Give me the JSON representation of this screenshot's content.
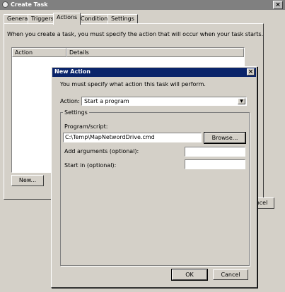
{
  "window": {
    "title": "Create Task",
    "tabs": [
      "General",
      "Triggers",
      "Actions",
      "Conditions",
      "Settings"
    ],
    "active_tab": "Actions",
    "instruction": "When you create a task, you must specify the action that will occur when your task starts.",
    "list_columns": [
      "Action",
      "Details"
    ],
    "new_button": "New...",
    "cancel_button_partial": "ncel"
  },
  "dialog": {
    "title": "New Action",
    "close_glyph": "×",
    "instruction": "You must specify what action this task will perform.",
    "action_label": "Action:",
    "action_value": "Start a program",
    "settings_label": "Settings",
    "program_label": "Program/script:",
    "program_value": "C:\\Temp\\MapNetwordDrive.cmd",
    "browse_button": "Browse...",
    "args_label": "Add arguments (optional):",
    "args_value": "",
    "startin_label": "Start in (optional):",
    "startin_value": "",
    "ok_button": "OK",
    "cancel_button": "Cancel"
  },
  "icons": {
    "dropdown": "chevron-down-icon",
    "close": "close-icon",
    "app": "task-icon"
  }
}
